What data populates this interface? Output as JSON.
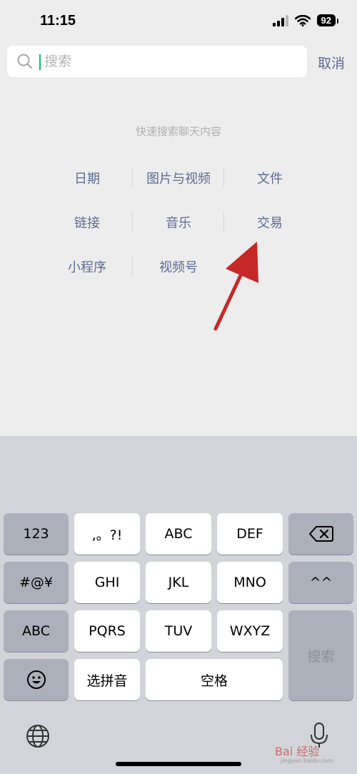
{
  "status_bar": {
    "time": "11:15",
    "battery": "92"
  },
  "search": {
    "placeholder": "搜索",
    "cancel_label": "取消"
  },
  "quick_search": {
    "hint": "快速搜索聊天内容",
    "items": [
      "日期",
      "图片与视频",
      "文件",
      "链接",
      "音乐",
      "交易",
      "小程序",
      "视频号"
    ]
  },
  "keyboard": {
    "num": "123",
    "punct": ",。?!",
    "abc": "ABC",
    "def": "DEF",
    "symbols": "#@¥",
    "ghi": "GHI",
    "jkl": "JKL",
    "mno": "MNO",
    "emoticon": "^^",
    "abc_switch": "ABC",
    "pqrs": "PQRS",
    "tuv": "TUV",
    "wxyz": "WXYZ",
    "search": "搜索",
    "pinyin": "选拼音",
    "space": "空格"
  },
  "watermark": {
    "brand": "Bai 经验",
    "sub": "jingyan.baidu.com"
  },
  "colors": {
    "link": "#5d6c94",
    "annotation_arrow": "#c62828",
    "caret": "#07c160"
  }
}
